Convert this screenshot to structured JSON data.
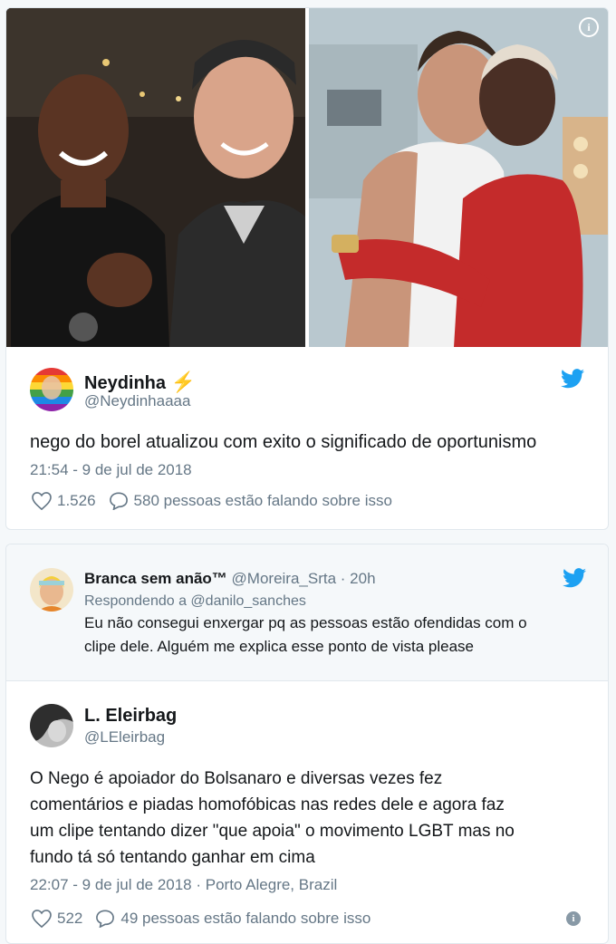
{
  "tweet1": {
    "name": "Neydinha",
    "emoji": "⚡",
    "handle": "@Neydinhaaaa",
    "text": "nego do borel atualizou com exito o significado de oportunismo",
    "timestamp": "21:54 - 9 de jul de 2018",
    "likes": "1.526",
    "replies": "580 pessoas estão falando sobre isso"
  },
  "quoted": {
    "name": "Branca sem anão™",
    "handle": "@Moreira_Srta",
    "time": "· 20h",
    "replying": "Respondendo a @danilo_sanches",
    "text_line1": "Eu não consegui enxergar pq as pessoas estão ofendidas com o",
    "text_line2": "clipe dele. Alguém me explica esse ponto de vista please"
  },
  "tweet2": {
    "name": "L. Eleirbag",
    "handle": "@LEleirbag",
    "line1": "O Nego é apoiador do Bolsanaro e diversas vezes fez",
    "line2": "comentários e piadas homofóbicas nas redes dele e agora faz",
    "line3": "um clipe tentando dizer \"que apoia\" o movimento LGBT mas no",
    "line4": "fundo tá só tentando ganhar em cima",
    "timestamp": "22:07 - 9 de jul de 2018 · Porto Alegre, Brazil",
    "likes": "522",
    "replies": "49 pessoas estão falando sobre isso"
  },
  "colors": {
    "twitter_blue": "#1da1f2",
    "secondary_text": "#657786"
  },
  "icons": [
    "info-icon",
    "twitter-bird-icon",
    "heart-icon",
    "comment-icon"
  ]
}
